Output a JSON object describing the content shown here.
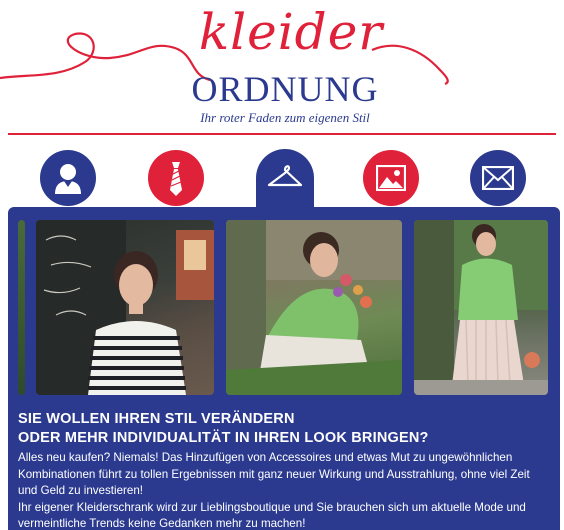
{
  "brand": {
    "logo_script": "kleider",
    "logo_main": "ORDNUNG",
    "tagline": "Ihr roter Faden zum eigenen Stil"
  },
  "colors": {
    "brand_red": "#e0213a",
    "brand_blue": "#2b3a8f",
    "text_on_panel": "#ffffff"
  },
  "nav": {
    "items": [
      {
        "icon": "person-icon",
        "color": "blue"
      },
      {
        "icon": "tie-icon",
        "color": "red"
      },
      {
        "icon": "hanger-icon",
        "color": "blue",
        "active": true
      },
      {
        "icon": "image-icon",
        "color": "red"
      },
      {
        "icon": "envelope-icon",
        "color": "blue"
      }
    ]
  },
  "content": {
    "headline_1": "SIE WOLLEN IHREN STIL VERÄNDERN",
    "headline_2": "ODER MEHR INDIVIDUALITÄT IN IHREN LOOK BRINGEN?",
    "paragraph_1": "Alles neu kaufen? Niemals! Das Hinzufügen von Accessoires und etwas Mut zu ungewöhnlichen Kombinationen führt zu tollen Ergebnissen mit ganz neuer Wirkung und Ausstrahlung, ohne viel Zeit und Geld zu investieren!",
    "paragraph_2": "Ihr eigener Kleiderschrank wird zur Lieblingsboutique und Sie brauchen sich um aktuelle Mode und vermeintliche Trends keine Gedanken mehr zu machen!"
  }
}
